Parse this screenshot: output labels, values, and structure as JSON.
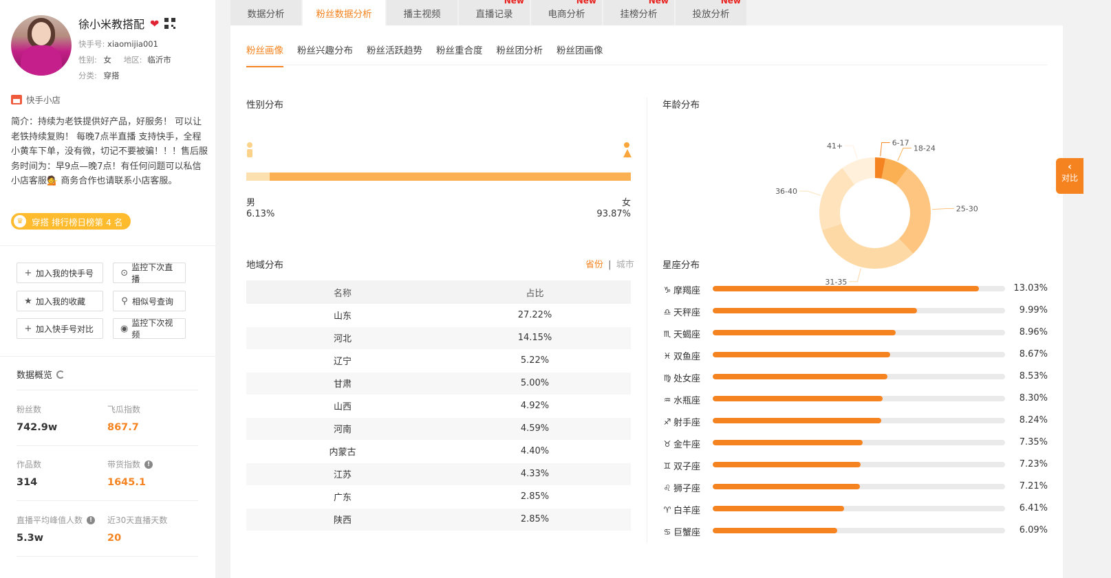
{
  "profile": {
    "name": "徐小米教搭配",
    "kuaishou_id_label": "快手号:",
    "kuaishou_id": "xiaomijia001",
    "gender_label": "性别:",
    "gender": "女",
    "region_label": "地区:",
    "region": "临沂市",
    "category_label": "分类:",
    "category": "穿搭",
    "shop_label": "快手小店",
    "intro": "简介：持续为老铁提供好产品，好服务！ 可以让老铁持续复购！ 每晚7点半直播 支持快手，全程小黄车下单，没有微，切记不要被骗！！！售后服务时间为：早9点—晚7点！有任何问题可以私信小店客服💁 商务合作也请联系小店客服。",
    "rank_badge": "穿搭 排行榜日榜第 4 名"
  },
  "actions": {
    "add_my_account": "加入我的快手号",
    "monitor_live": "监控下次直播",
    "add_favorite": "加入我的收藏",
    "similar_search": "相似号查询",
    "add_compare": "加入快手号对比",
    "monitor_video": "监控下次视频"
  },
  "overview": {
    "title": "数据概览",
    "fans_label": "粉丝数",
    "fans_value": "742.9w",
    "feigua_label": "飞瓜指数",
    "feigua_value": "867.7",
    "works_label": "作品数",
    "works_value": "314",
    "sales_index_label": "带货指数",
    "sales_index_value": "1645.1",
    "live_peak_label": "直播平均峰值人数",
    "live_peak_value": "5.3w",
    "live_days_label": "近30天直播天数",
    "live_days_value": "20"
  },
  "tabs": [
    {
      "label": "数据分析",
      "new": ""
    },
    {
      "label": "粉丝数据分析",
      "new": ""
    },
    {
      "label": "播主视频",
      "new": ""
    },
    {
      "label": "直播记录",
      "new": "New"
    },
    {
      "label": "电商分析",
      "new": "New"
    },
    {
      "label": "挂榜分析",
      "new": "New"
    },
    {
      "label": "投放分析",
      "new": "New"
    }
  ],
  "subtabs": [
    "粉丝画像",
    "粉丝兴趣分布",
    "粉丝活跃趋势",
    "粉丝重合度",
    "粉丝团分析",
    "粉丝团画像"
  ],
  "gender_section": {
    "title": "性别分布",
    "male_label": "男",
    "male_pct": "6.13%",
    "male_value": 6.13,
    "female_label": "女",
    "female_pct": "93.87%",
    "female_value": 93.87
  },
  "region_section": {
    "title": "地域分布",
    "toggle_province": "省份",
    "toggle_sep": "|",
    "toggle_city": "城市",
    "col_name": "名称",
    "col_ratio": "占比",
    "rows": [
      {
        "name": "山东",
        "ratio": "27.22%"
      },
      {
        "name": "河北",
        "ratio": "14.15%"
      },
      {
        "name": "辽宁",
        "ratio": "5.22%"
      },
      {
        "name": "甘肃",
        "ratio": "5.00%"
      },
      {
        "name": "山西",
        "ratio": "4.92%"
      },
      {
        "name": "河南",
        "ratio": "4.59%"
      },
      {
        "name": "内蒙古",
        "ratio": "4.40%"
      },
      {
        "name": "江苏",
        "ratio": "4.33%"
      },
      {
        "name": "广东",
        "ratio": "2.85%"
      },
      {
        "name": "陕西",
        "ratio": "2.85%"
      }
    ]
  },
  "age_section": {
    "title": "年龄分布"
  },
  "zodiac_section": {
    "title": "星座分布",
    "rows": [
      {
        "sym": "♑",
        "name": "摩羯座",
        "pct": "13.03%"
      },
      {
        "sym": "♎",
        "name": "天秤座",
        "pct": "9.99%"
      },
      {
        "sym": "♏",
        "name": "天蝎座",
        "pct": "8.96%"
      },
      {
        "sym": "♓",
        "name": "双鱼座",
        "pct": "8.67%"
      },
      {
        "sym": "♍",
        "name": "处女座",
        "pct": "8.53%"
      },
      {
        "sym": "♒",
        "name": "水瓶座",
        "pct": "8.30%"
      },
      {
        "sym": "♐",
        "name": "射手座",
        "pct": "8.24%"
      },
      {
        "sym": "♉",
        "name": "金牛座",
        "pct": "7.35%"
      },
      {
        "sym": "♊",
        "name": "双子座",
        "pct": "7.23%"
      },
      {
        "sym": "♌",
        "name": "狮子座",
        "pct": "7.21%"
      },
      {
        "sym": "♈",
        "name": "白羊座",
        "pct": "6.41%"
      },
      {
        "sym": "♋",
        "name": "巨蟹座",
        "pct": "6.09%"
      }
    ]
  },
  "chart_data": [
    {
      "type": "pie",
      "title": "年龄分布",
      "categories": [
        "6-17",
        "18-24",
        "25-30",
        "31-35",
        "36-40",
        "41+"
      ],
      "values": [
        3,
        7,
        28,
        32,
        20,
        10
      ]
    },
    {
      "type": "bar",
      "title": "星座分布",
      "categories": [
        "摩羯座",
        "天秤座",
        "天蝎座",
        "双鱼座",
        "处女座",
        "水瓶座",
        "射手座",
        "金牛座",
        "双子座",
        "狮子座",
        "白羊座",
        "巨蟹座"
      ],
      "values": [
        13.03,
        9.99,
        8.96,
        8.67,
        8.53,
        8.3,
        8.24,
        7.35,
        7.23,
        7.21,
        6.41,
        6.09
      ]
    }
  ],
  "colors": {
    "accent": "#f5831f",
    "donut": [
      "#f5831f",
      "#fbb054",
      "#fdc57f",
      "#fdd9a6",
      "#fee3bc",
      "#fff0dc"
    ]
  },
  "compare_float": "对比"
}
